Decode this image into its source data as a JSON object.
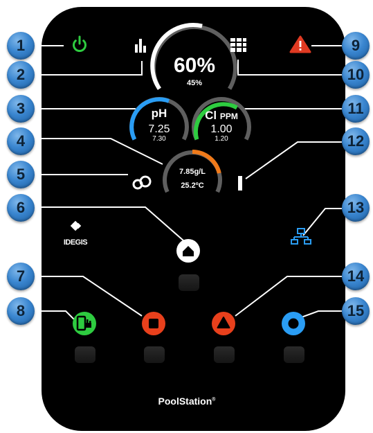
{
  "callouts": [
    "1",
    "2",
    "3",
    "4",
    "5",
    "6",
    "7",
    "8",
    "9",
    "10",
    "11",
    "12",
    "13",
    "14",
    "15"
  ],
  "production": {
    "main_value": "60%",
    "setpoint": "45%"
  },
  "ph": {
    "label": "pH",
    "value": "7.25",
    "setpoint": "7.30"
  },
  "cl": {
    "label_cl": "Cl",
    "label_ppm": "PPM",
    "value": "1.00",
    "setpoint": "1.20"
  },
  "salinity": {
    "value": "7.85g/L",
    "temperature": "25.2ºC"
  },
  "brand": {
    "logo_text": "IDEGIS",
    "product_name": "PoolStation",
    "registered_mark": "®"
  },
  "info_glyph": "i",
  "colors": {
    "power": "#2ecc40",
    "alarm": "#e03a22",
    "ph_arc": "#2a9df4",
    "cl_arc": "#2ecc40",
    "salinity_arc": "#f07a1a",
    "stop_button": "#e8401c",
    "up_button": "#e8401c",
    "circle_button": "#2a9df4",
    "network": "#2a9df4"
  },
  "icons": [
    "power-icon",
    "bar-chart-icon",
    "grid-menu-icon",
    "alarm-warning-icon",
    "flow-link-icon",
    "info-icon",
    "home-icon",
    "network-icon",
    "dosing-pump-icon",
    "stop-icon",
    "triangle-up-icon",
    "circle-icon"
  ]
}
